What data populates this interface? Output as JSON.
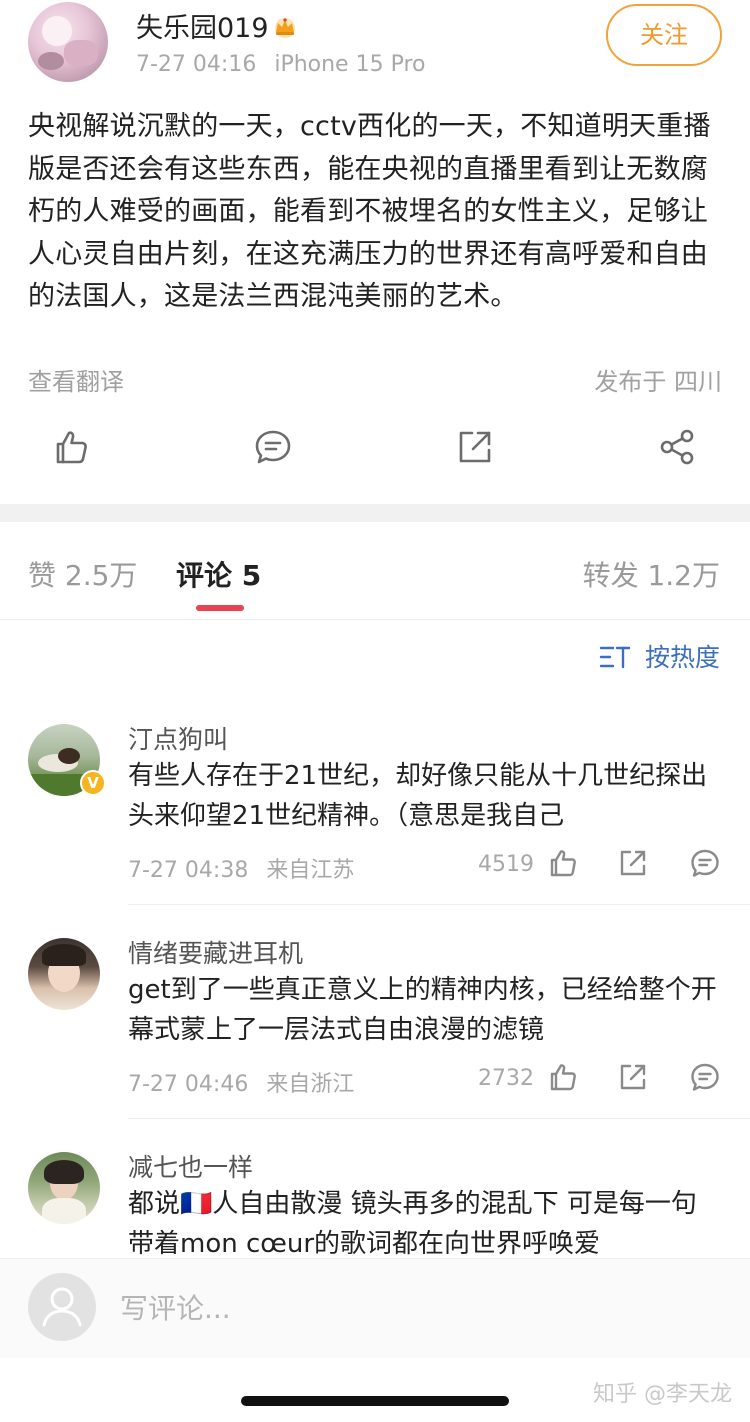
{
  "post": {
    "username": "失乐园019",
    "badge_icon": "crown-icon",
    "time": "7-27 04:16",
    "device": "iPhone 15 Pro",
    "follow_label": "关注",
    "body": "央视解说沉默的一天，cctv西化的一天，不知道明天重播版是否还会有这些东西，能在央视的直播里看到让无数腐朽的人难受的画面，能看到不被埋名的女性主义，足够让人心灵自由片刻，在这充满压力的世界还有高呼爱和自由的法国人，这是法兰西混沌美丽的艺术。",
    "translate_label": "查看翻译",
    "location": "发布于 四川"
  },
  "actions": [
    "like-icon",
    "comment-icon",
    "repost-icon",
    "share-icon"
  ],
  "tabs": {
    "likes": "赞 2.5万",
    "comments": "评论 5",
    "reposts": "转发 1.2万"
  },
  "sort_label": "按热度",
  "comments": [
    {
      "name": "汀点狗叫",
      "text": "有些人存在于21世纪，却好像只能从十几世纪探出头来仰望21世纪精神。（意思是我自己",
      "time": "7-27 04:38",
      "from": "来自江苏",
      "likes": "4519",
      "verified": "V"
    },
    {
      "name": "情绪要藏进耳机",
      "text": "get到了一些真正意义上的精神内核，已经给整个开幕式蒙上了一层法式自由浪漫的滤镜",
      "time": "7-27 04:46",
      "from": "来自浙江",
      "likes": "2732"
    },
    {
      "name": "减七也一样",
      "text": "都说🇫🇷人自由散漫 镜头再多的混乱下 可是每一句带着mon cœur的歌词都在向世界呼唤爱"
    }
  ],
  "input_placeholder": "写评论...",
  "watermark": "知乎 @李天龙",
  "colors": {
    "accent_orange": "#f09a2e",
    "tab_underline": "#e8434f",
    "sort_blue": "#3c6fbf",
    "verified_badge": "#f6b51e"
  }
}
